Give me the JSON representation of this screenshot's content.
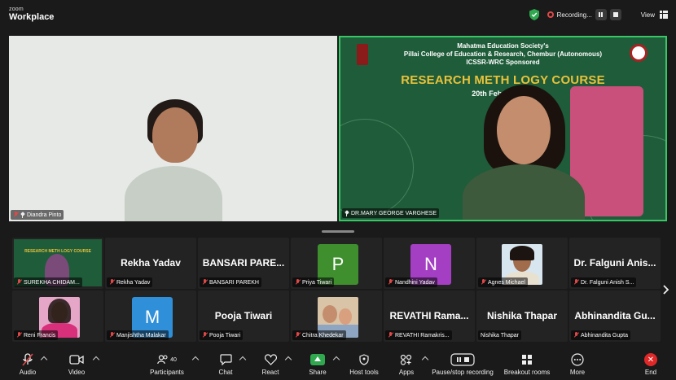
{
  "app": {
    "brand_top": "zoom",
    "brand_main": "Workplace"
  },
  "topbar": {
    "recording_label": "Recording...",
    "view_label": "View",
    "colors": {
      "shield": "#2fa84f",
      "recording": "#e04848"
    }
  },
  "main_tiles": [
    {
      "name": "Diandra Pinto"
    },
    {
      "name": "DR.MARY GEORGE VARGHESE",
      "banner_line1": "Mahatma Education Society's",
      "banner_line2": "Pillai College of Education & Research, Chembur (Autonomous)",
      "banner_line3": "ICSSR-WRC Sponsored",
      "banner_course": "RESEARCH METH     LOGY COURSE",
      "banner_date": "20th Febru                    h 2025",
      "active_speaker_color": "#37c865"
    }
  ],
  "gallery": {
    "row1": [
      {
        "tag": "SUREKHA CHIDAM...",
        "kind": "video"
      },
      {
        "display": "Rekha Yadav",
        "tag": "Rekha Yadav",
        "kind": "name"
      },
      {
        "display": "BANSARI PARE...",
        "tag": "BANSARI PAREKH",
        "kind": "name"
      },
      {
        "letter": "P",
        "tag": "Priya Tiwari",
        "kind": "avatar",
        "color": "#3f8f2f"
      },
      {
        "letter": "N",
        "tag": "Nandhini Yadav",
        "kind": "avatar",
        "color": "#a43fc4"
      },
      {
        "tag": "Agnes Michael",
        "kind": "photo"
      },
      {
        "display": "Dr. Falguni Anis...",
        "tag": "Dr. Falguni Anish S...",
        "kind": "name"
      }
    ],
    "row2": [
      {
        "tag": "Reni Francis",
        "kind": "photo"
      },
      {
        "letter": "M",
        "tag": "Manjishtha Malakar",
        "kind": "avatar",
        "color": "#2f8fd8"
      },
      {
        "display": "Pooja Tiwari",
        "tag": "Pooja Tiwari",
        "kind": "name"
      },
      {
        "tag": "Chitra Khedekar",
        "kind": "photo"
      },
      {
        "display": "REVATHI Rama...",
        "tag": "REVATHI Ramakris...",
        "kind": "name"
      },
      {
        "display": "Nishika Thapar",
        "tag": "Nishika Thapar",
        "kind": "name"
      },
      {
        "display": "Abhinandita Gu...",
        "tag": "Abhinandita Gupta",
        "kind": "name"
      }
    ],
    "mini_course": "RESEARCH METH LOGY COURSE"
  },
  "toolbar": {
    "audio": "Audio",
    "video": "Video",
    "participants": "Participants",
    "participants_count": "40",
    "chat": "Chat",
    "react": "React",
    "share": "Share",
    "host_tools": "Host tools",
    "apps": "Apps",
    "pause_recording": "Pause/stop recording",
    "breakout": "Breakout rooms",
    "more": "More",
    "end": "End",
    "end_symbol": "✕",
    "colors": {
      "share": "#2fa84f",
      "end": "#e02828"
    }
  }
}
